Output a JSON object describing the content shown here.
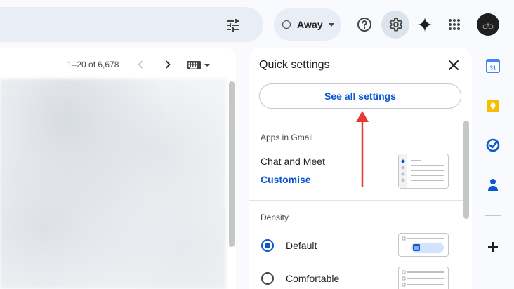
{
  "header": {
    "status_label": "Away"
  },
  "mail_list": {
    "pager_text": "1–20 of 6,678"
  },
  "quick_settings": {
    "title": "Quick settings",
    "see_all_label": "See all settings",
    "apps_heading": "Apps in Gmail",
    "chat_meet_label": "Chat and Meet",
    "customise_label": "Customise",
    "density_heading": "Density",
    "density_options": [
      {
        "label": "Default",
        "selected": true
      },
      {
        "label": "Comfortable",
        "selected": false
      }
    ]
  },
  "side_rail": {
    "icons": [
      "calendar-icon",
      "keep-icon",
      "tasks-icon",
      "contacts-icon",
      "add-icon"
    ],
    "calendar_day": "31"
  },
  "colors": {
    "accent": "#0b57d0",
    "annotation_arrow": "#e53935"
  }
}
